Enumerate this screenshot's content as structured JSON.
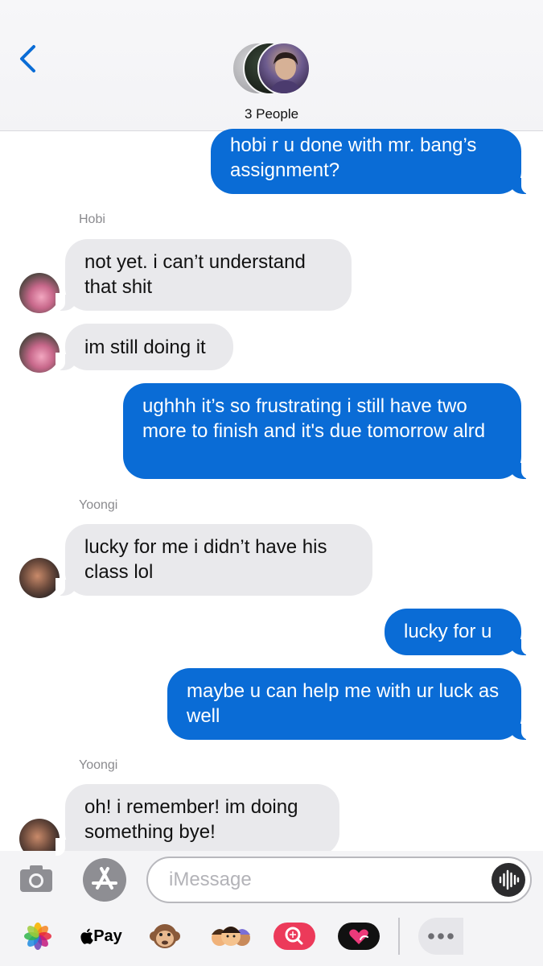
{
  "header": {
    "title": "3 People",
    "back_icon": "chevron-left-icon",
    "accent_color": "#0a6cd6"
  },
  "messages": [
    {
      "direction": "outgoing",
      "text": "hobi r u done with mr. bang’s assignment?"
    },
    {
      "direction": "incoming",
      "sender": "Hobi",
      "text": "not yet. i can’t understand that shit"
    },
    {
      "direction": "incoming",
      "sender": "Hobi",
      "text": "im still doing it"
    },
    {
      "direction": "outgoing",
      "text": "ughhh it’s so frustrating i still have two more to finish and it's due tomorrow alrd"
    },
    {
      "direction": "incoming",
      "sender": "Yoongi",
      "text": "lucky for me i didn’t have his class lol"
    },
    {
      "direction": "outgoing",
      "text": "lucky for u"
    },
    {
      "direction": "outgoing",
      "text": "maybe u can help me with ur luck as well"
    },
    {
      "direction": "incoming",
      "sender": "Yoongi",
      "text": "oh! i remember! im doing something bye!"
    }
  ],
  "composer": {
    "placeholder": "iMessage",
    "value": "",
    "camera_icon": "camera-icon",
    "apps_icon": "app-store-icon",
    "audio_icon": "audio-waveform-icon"
  },
  "app_drawer": {
    "items": [
      {
        "name": "photos-icon"
      },
      {
        "name": "apple-pay",
        "label": "Pay"
      },
      {
        "name": "monkey-animoji-icon"
      },
      {
        "name": "memoji-icon"
      },
      {
        "name": "search-images-icon"
      },
      {
        "name": "digital-touch-icon"
      }
    ],
    "more_icon": "more-icon"
  },
  "colors": {
    "outgoing_bubble": "#0a6cd6",
    "incoming_bubble": "#e9e9ec",
    "sender_label": "#8a8a8e"
  }
}
